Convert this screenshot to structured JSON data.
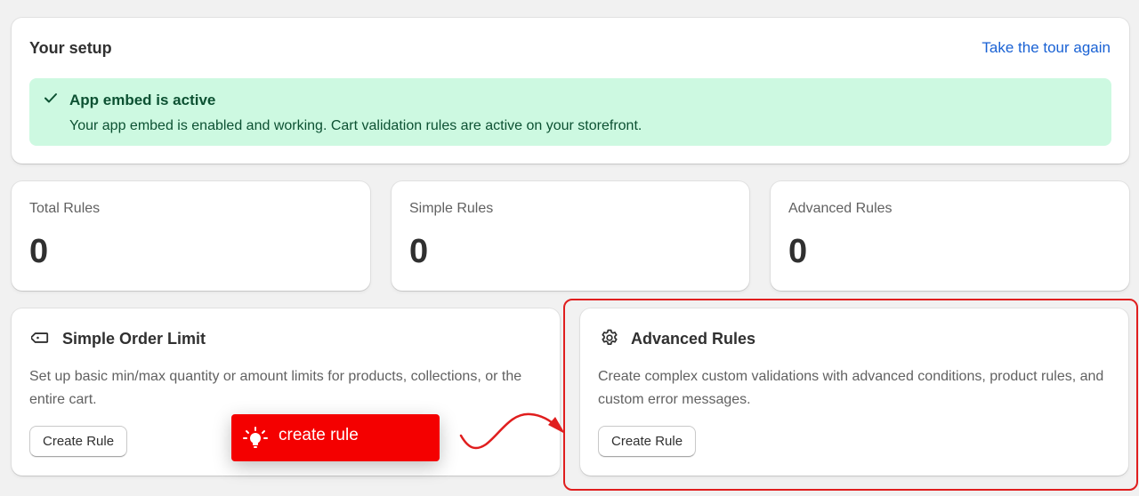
{
  "setup": {
    "title": "Your setup",
    "tour_link": "Take the tour again",
    "banner": {
      "title": "App embed is active",
      "text": "Your app embed is enabled and working. Cart validation rules are active on your storefront."
    }
  },
  "stats": [
    {
      "label": "Total Rules",
      "value": "0"
    },
    {
      "label": "Simple Rules",
      "value": "0"
    },
    {
      "label": "Advanced Rules",
      "value": "0"
    }
  ],
  "simple_card": {
    "icon": "tag-icon",
    "title": "Simple Order Limit",
    "description": "Set up basic min/max quantity or amount limits for products, collections, or the entire cart.",
    "button": "Create Rule"
  },
  "advanced_card": {
    "icon": "gear-icon",
    "title": "Advanced Rules",
    "description": "Create complex custom validations with advanced conditions, product rules, and custom error messages.",
    "button": "Create Rule"
  },
  "callout": {
    "icon": "lightbulb-icon",
    "text": "create rule"
  },
  "colors": {
    "link": "#1a62d4",
    "banner_bg": "#cdf9e1",
    "banner_text": "#0c5132",
    "highlight": "#e01e1e",
    "callout_bg": "#f40000"
  }
}
